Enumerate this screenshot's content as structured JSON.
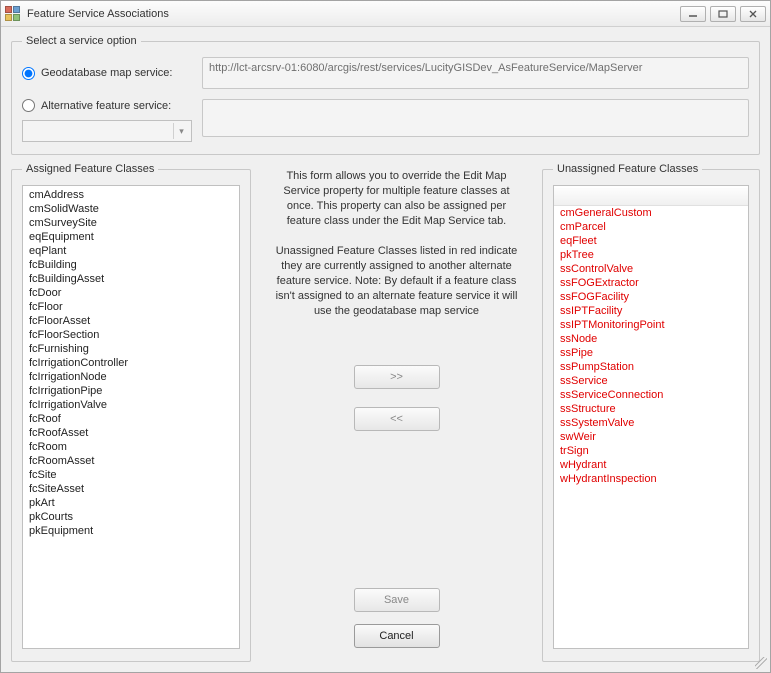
{
  "window": {
    "title": "Feature Service Associations"
  },
  "service_option": {
    "legend": "Select a service option",
    "geo_label": "Geodatabase map service:",
    "geo_selected": true,
    "geo_url": "http://lct-arcsrv-01:6080/arcgis/rest/services/LucityGISDev_AsFeatureService/MapServer",
    "alt_label": "Alternative feature service:",
    "alt_selected": false
  },
  "assigned": {
    "legend": "Assigned Feature Classes",
    "items": [
      "cmAddress",
      "cmSolidWaste",
      "cmSurveySite",
      "eqEquipment",
      "eqPlant",
      "fcBuilding",
      "fcBuildingAsset",
      "fcDoor",
      "fcFloor",
      "fcFloorAsset",
      "fcFloorSection",
      "fcFurnishing",
      "fcIrrigationController",
      "fcIrrigationNode",
      "fcIrrigationPipe",
      "fcIrrigationValve",
      "fcRoof",
      "fcRoofAsset",
      "fcRoom",
      "fcRoomAsset",
      "fcSite",
      "fcSiteAsset",
      "pkArt",
      "pkCourts",
      "pkEquipment"
    ]
  },
  "mid": {
    "para1": "This form allows you to override the Edit Map Service property for multiple feature classes at once.  This property can also be assigned per feature class under the Edit Map Service tab.",
    "para2": "Unassigned Feature Classes listed in red indicate they are currently assigned to another alternate feature service.  Note:  By default if a feature class isn't assigned to an alternate feature service it will use the geodatabase map service",
    "move_right": ">>",
    "move_left": "<<",
    "save": "Save",
    "cancel": "Cancel"
  },
  "unassigned": {
    "legend": "Unassigned Feature Classes",
    "items": [
      "cmGeneralCustom",
      "cmParcel",
      "eqFleet",
      "pkTree",
      "ssControlValve",
      "ssFOGExtractor",
      "ssFOGFacility",
      "ssIPTFacility",
      "ssIPTMonitoringPoint",
      "ssNode",
      "ssPipe",
      "ssPumpStation",
      "ssService",
      "ssServiceConnection",
      "ssStructure",
      "ssSystemValve",
      "swWeir",
      "trSign",
      "wHydrant",
      "wHydrantInspection"
    ]
  }
}
